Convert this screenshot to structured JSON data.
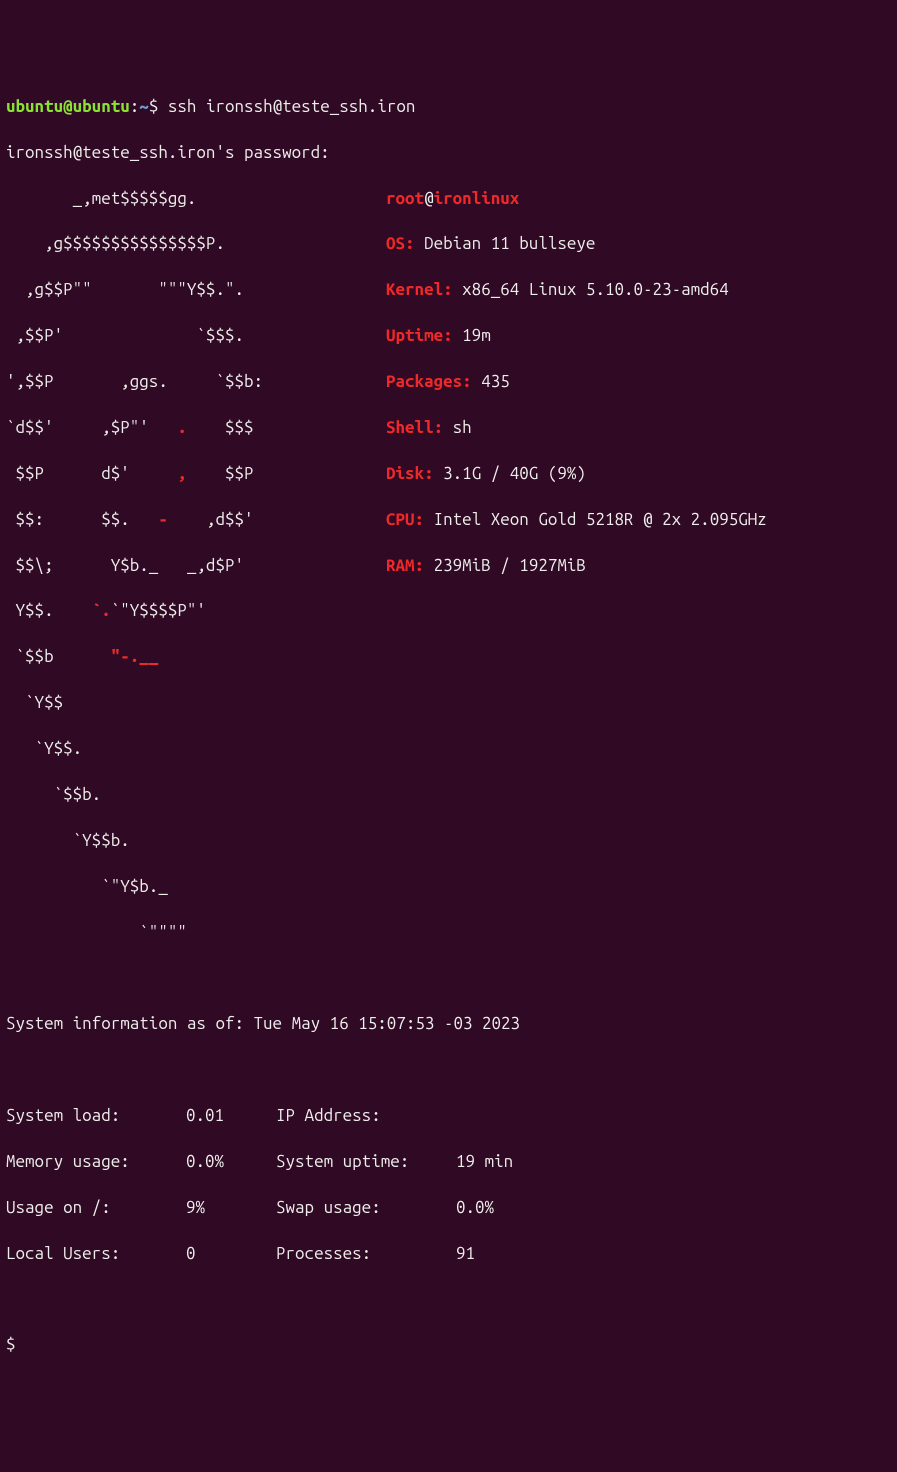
{
  "prompt": {
    "user": "ubuntu@ubuntu",
    "colon": ":",
    "path": "~",
    "dollar": "$",
    "command": "ssh ironssh@teste_ssh.iron"
  },
  "password_line": "ironssh@teste_ssh.iron's password:",
  "ascii": {
    "l0": "       _,met$$$$$gg.          ",
    "l1": "    ,g$$$$$$$$$$$$$$$P.       ",
    "l2": "  ,g$$P\"\"       \"\"\"Y$$.\".     ",
    "l3": " ,$$P'              `$$$.     ",
    "l4": "',$$P       ,ggs.     `$$b:   ",
    "l5": "`d$$'     ,$P\"'   .    $$$    ",
    "l6": " $$P      d$'     ,    $$P    ",
    "l7": " $$:      $$.   -    ,d$$'    ",
    "l8": " $$\\;      Y$b._   _,d$P'     ",
    "l9": " Y$$.    `.`\"Y$$$$P\"'         ",
    "l9a": " Y$$.    ",
    "l9b": "`.",
    "l9c": "`\"Y$$$$P\"'         ",
    "l10a": " `$$b      ",
    "l10b": "\"-.__              ",
    "l11": "  `Y$$                        ",
    "l12": "   `Y$$.                      ",
    "l13": "     `$$b.                    ",
    "l14": "       `Y$$b.                 ",
    "l15": "          `\"Y$b._             ",
    "l16": "              `\"\"\"\"           "
  },
  "neofetch": {
    "user": "root",
    "at": "@",
    "host": "ironlinux",
    "os_label": "OS:",
    "os_val": " Debian 11 bullseye",
    "kernel_label": "Kernel:",
    "kernel_val": " x86_64 Linux 5.10.0-23-amd64",
    "uptime_label": "Uptime:",
    "uptime_val": " 19m",
    "packages_label": "Packages:",
    "packages_val": " 435",
    "shell_label": "Shell:",
    "shell_val": " sh",
    "disk_label": "Disk:",
    "disk_val": " 3.1G / 40G (9%)",
    "cpu_label": "CPU:",
    "cpu_val": " Intel Xeon Gold 5218R @ 2x 2.095GHz",
    "ram_label": "RAM:",
    "ram_val": " 239MiB / 1927MiB"
  },
  "sysinfo_header": "System information as of: Tue May 16 15:07:53 -03 2023",
  "sysinfo": {
    "load_label": "System load:",
    "load_val": "0.01",
    "ip_label": "IP Address:",
    "ip_val": "",
    "mem_label": "Memory usage:",
    "mem_val": "0.0%",
    "uptime_label": "System uptime:",
    "uptime_val": "19 min",
    "usage_label": "Usage on /:",
    "usage_val": "9%",
    "swap_label": "Swap usage:",
    "swap_val": "0.0%",
    "users_label": "Local Users:",
    "users_val": "0",
    "proc_label": "Processes:",
    "proc_val": "91"
  },
  "final_prompt": "$"
}
